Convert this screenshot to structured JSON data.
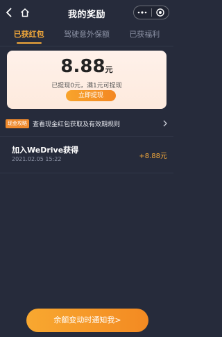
{
  "header": {
    "title": "我的奖励",
    "back_icon": "chevron-left-icon",
    "home_icon": "home-icon",
    "more_icon": "more-dots-icon",
    "close_icon": "target-close-icon"
  },
  "tabs": [
    {
      "label": "已获红包",
      "active": true
    },
    {
      "label": "驾驶意外保额",
      "active": false
    },
    {
      "label": "已获福利",
      "active": false
    }
  ],
  "card": {
    "amount": "8.88",
    "unit": "元",
    "note": "已提现0元，满1元可提现",
    "withdraw_label": "立即提现"
  },
  "strategy": {
    "badge": "现金攻略",
    "text": "查看现金红包获取及有效期规则"
  },
  "records": [
    {
      "title": "加入WeDrive获得",
      "time": "2021.02.05 15:22",
      "amount": "+8.88元"
    }
  ],
  "footer": {
    "notify_label": "余额变动时通知我>"
  },
  "colors": {
    "background": "#262b3b",
    "accent": "#f4a93a",
    "card": "#fdeadd"
  }
}
